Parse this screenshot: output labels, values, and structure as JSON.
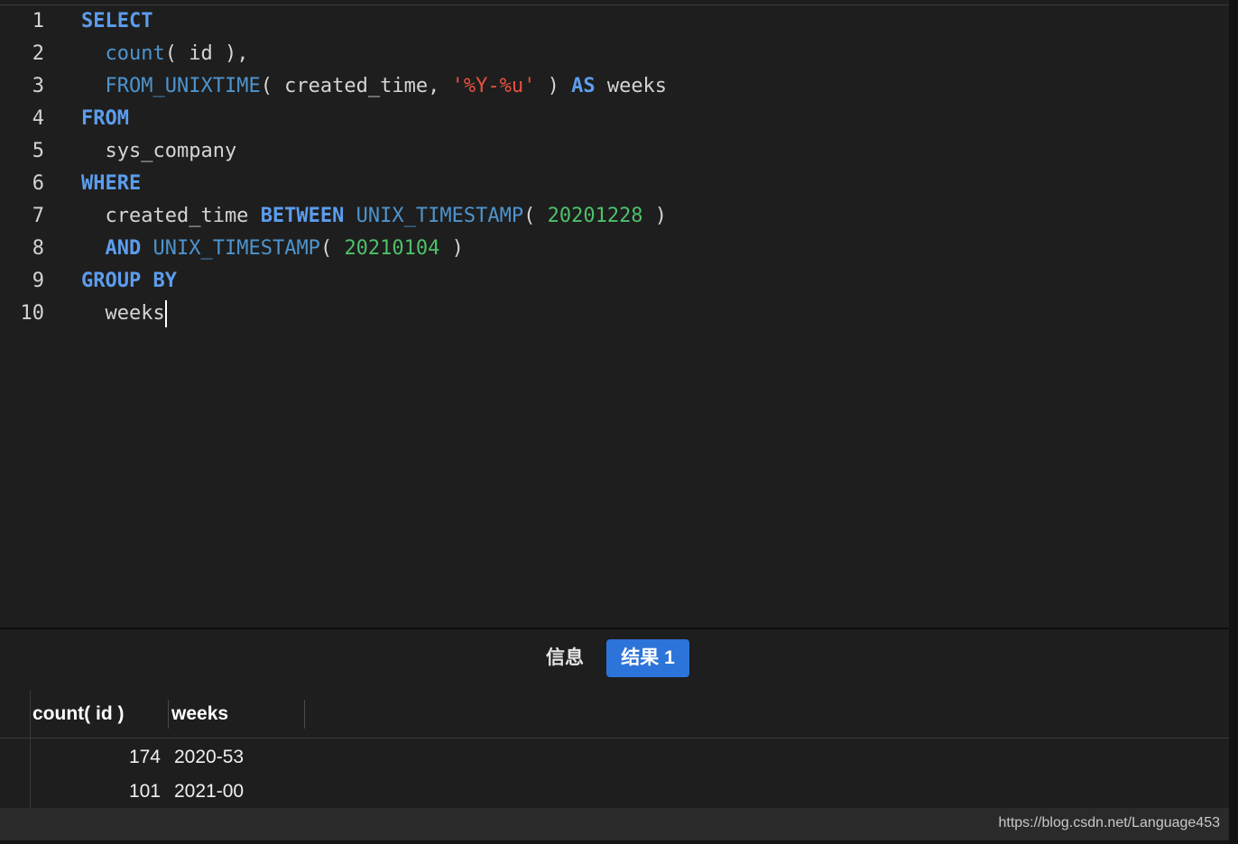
{
  "editor": {
    "lines": [
      {
        "no": "1",
        "tokens": [
          {
            "t": "SELECT",
            "c": "kw"
          }
        ]
      },
      {
        "no": "2",
        "tokens": [
          {
            "t": "  ",
            "c": "plain"
          },
          {
            "t": "count",
            "c": "fn"
          },
          {
            "t": "( id ),",
            "c": "plain"
          }
        ]
      },
      {
        "no": "3",
        "tokens": [
          {
            "t": "  ",
            "c": "plain"
          },
          {
            "t": "FROM_UNIXTIME",
            "c": "fn"
          },
          {
            "t": "( created_time, ",
            "c": "plain"
          },
          {
            "t": "'%Y-%u'",
            "c": "str"
          },
          {
            "t": " ) ",
            "c": "plain"
          },
          {
            "t": "AS",
            "c": "kw"
          },
          {
            "t": " weeks",
            "c": "plain"
          }
        ]
      },
      {
        "no": "4",
        "tokens": [
          {
            "t": "FROM",
            "c": "kw"
          }
        ]
      },
      {
        "no": "5",
        "tokens": [
          {
            "t": "  sys_company",
            "c": "plain"
          }
        ]
      },
      {
        "no": "6",
        "tokens": [
          {
            "t": "WHERE",
            "c": "kw"
          }
        ]
      },
      {
        "no": "7",
        "tokens": [
          {
            "t": "  created_time ",
            "c": "plain"
          },
          {
            "t": "BETWEEN",
            "c": "kw"
          },
          {
            "t": " ",
            "c": "plain"
          },
          {
            "t": "UNIX_TIMESTAMP",
            "c": "fn"
          },
          {
            "t": "( ",
            "c": "plain"
          },
          {
            "t": "20201228",
            "c": "num"
          },
          {
            "t": " )",
            "c": "plain"
          }
        ]
      },
      {
        "no": "8",
        "tokens": [
          {
            "t": "  ",
            "c": "plain"
          },
          {
            "t": "AND",
            "c": "kw"
          },
          {
            "t": " ",
            "c": "plain"
          },
          {
            "t": "UNIX_TIMESTAMP",
            "c": "fn"
          },
          {
            "t": "( ",
            "c": "plain"
          },
          {
            "t": "20210104",
            "c": "num"
          },
          {
            "t": " )",
            "c": "plain"
          }
        ]
      },
      {
        "no": "9",
        "tokens": [
          {
            "t": "GROUP BY",
            "c": "kw"
          }
        ]
      },
      {
        "no": "10",
        "tokens": [
          {
            "t": "  weeks",
            "c": "plain"
          }
        ]
      }
    ]
  },
  "tabs": {
    "info_label": "信息",
    "result_label": "结果 1"
  },
  "grid": {
    "columns": [
      "count( id )",
      "weeks"
    ],
    "rows": [
      [
        "174",
        "2020-53"
      ],
      [
        "101",
        "2021-00"
      ]
    ]
  },
  "watermark": "https://blog.csdn.net/Language453",
  "colors": {
    "keyword": "#5c9ded",
    "function": "#4e94ce",
    "string": "#e9503f",
    "number": "#4ec06a",
    "active_tab": "#2d74da"
  }
}
